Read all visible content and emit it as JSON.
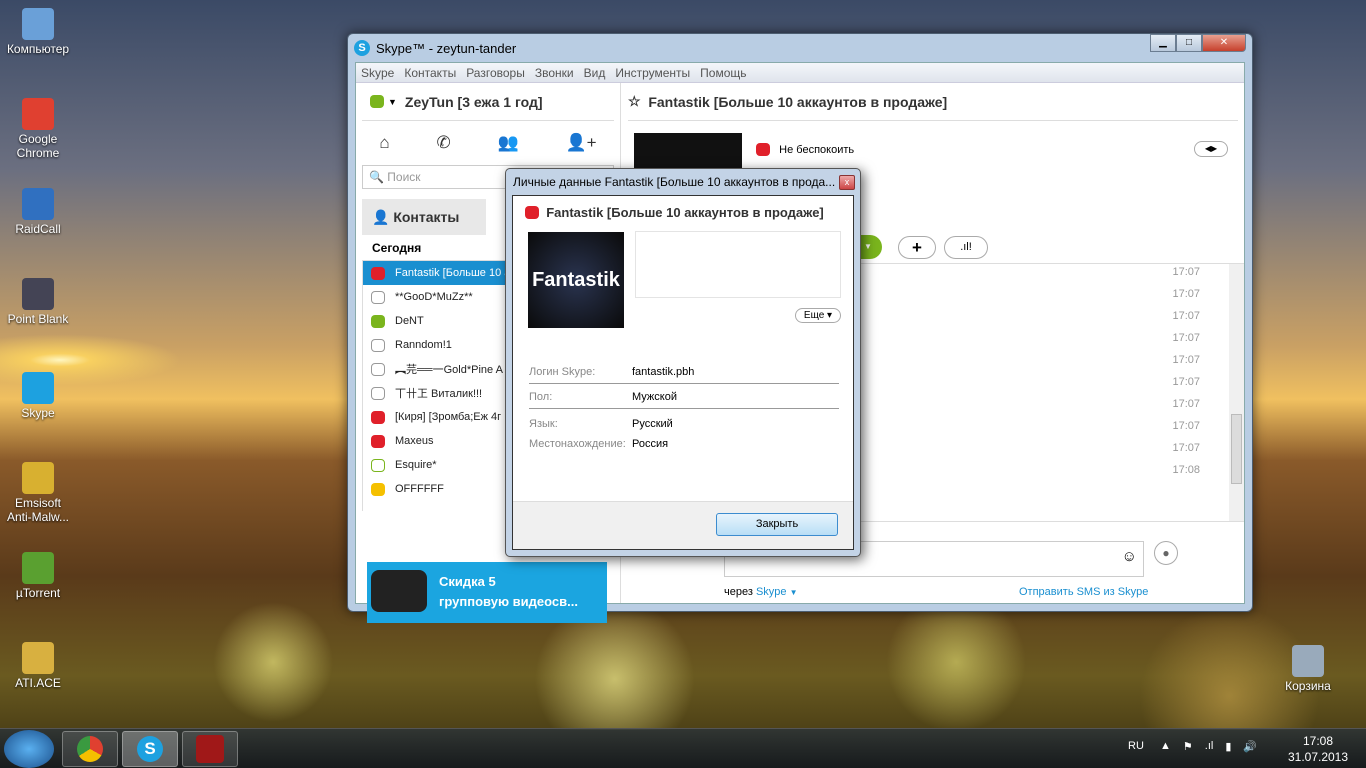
{
  "desktop": {
    "icons": [
      {
        "label": "Компьютер",
        "color": "#6aa0d8"
      },
      {
        "label": "Google Chrome",
        "color": "#e04030"
      },
      {
        "label": "RaidCall",
        "color": "#3070c0"
      },
      {
        "label": "Point Blank",
        "color": "#445"
      },
      {
        "label": "Skype",
        "color": "#1da1e0"
      },
      {
        "label": "Emsisoft Anti-Malw...",
        "color": "#d8b030"
      },
      {
        "label": "µTorrent",
        "color": "#5aa030"
      },
      {
        "label": "ATI.ACE",
        "color": "#d8b040"
      }
    ],
    "recycle_bin": "Корзина"
  },
  "skype": {
    "title": "Skype™ - zeytun-tander",
    "menu": [
      "Skype",
      "Контакты",
      "Разговоры",
      "Звонки",
      "Вид",
      "Инструменты",
      "Помощь"
    ],
    "user": "ZeyTun [3 ежа 1 год]",
    "search_placeholder": "Поиск",
    "tab_contacts": "Контакты",
    "section": "Сегодня",
    "contacts": [
      {
        "name": "Fantastik [Больше 10 а",
        "status": "dnd",
        "selected": true
      },
      {
        "name": "**GooD*MuZz**",
        "status": "unknown"
      },
      {
        "name": "DeNT",
        "status": "online"
      },
      {
        "name": "Ranndom!1",
        "status": "unknown"
      },
      {
        "name": "︻芫══一Gold*Pine A",
        "status": "unknown"
      },
      {
        "name": "丅卄㠪 Виталик!!!",
        "status": "unknown"
      },
      {
        "name": "[Киря] [Зромба;Еж 4г",
        "status": "dnd"
      },
      {
        "name": "Maxeus",
        "status": "dnd"
      },
      {
        "name": "Esquire*",
        "status": "offline-green"
      },
      {
        "name": "OFFFFFF",
        "status": "away"
      }
    ],
    "promo": {
      "line1": "Скидка 5",
      "line2": "групповую видеосв..."
    },
    "chat": {
      "title": "Fantastik [Больше 10 аккаунтов в продаже]",
      "status": "Не беспокоить",
      "timestamps": [
        "17:07",
        "17:07",
        "17:07",
        "17:07",
        "17:07",
        "17:07",
        "17:07",
        "17:07",
        "17:07",
        "17:08"
      ],
      "via_label": "через",
      "via_link": "Skype",
      "sms_link": "Отправить SMS из Skype"
    }
  },
  "dialog": {
    "title": "Личные данные Fantastik [Больше 10 аккаунтов в прода...",
    "name": "Fantastik [Больше 10 аккаунтов в продаже]",
    "avatar_text": "Fantastik",
    "more": "Еще",
    "fields": [
      {
        "k": "Логин Skype:",
        "v": "fantastik.pbh"
      },
      {
        "k": "Пол:",
        "v": "Мужской"
      },
      {
        "k": "Язык:",
        "v": "Русский"
      },
      {
        "k": "Местонахождение:",
        "v": "Россия"
      }
    ],
    "close": "Закрыть"
  },
  "tray": {
    "lang": "RU",
    "time": "17:08",
    "date": "31.07.2013"
  },
  "colors": {
    "dnd": "#e0202a",
    "online": "#7ab51d",
    "away": "#f5c000",
    "unknown": "#999999",
    "offline-green": "#7ab51d",
    "accent": "#1a8fd0"
  }
}
